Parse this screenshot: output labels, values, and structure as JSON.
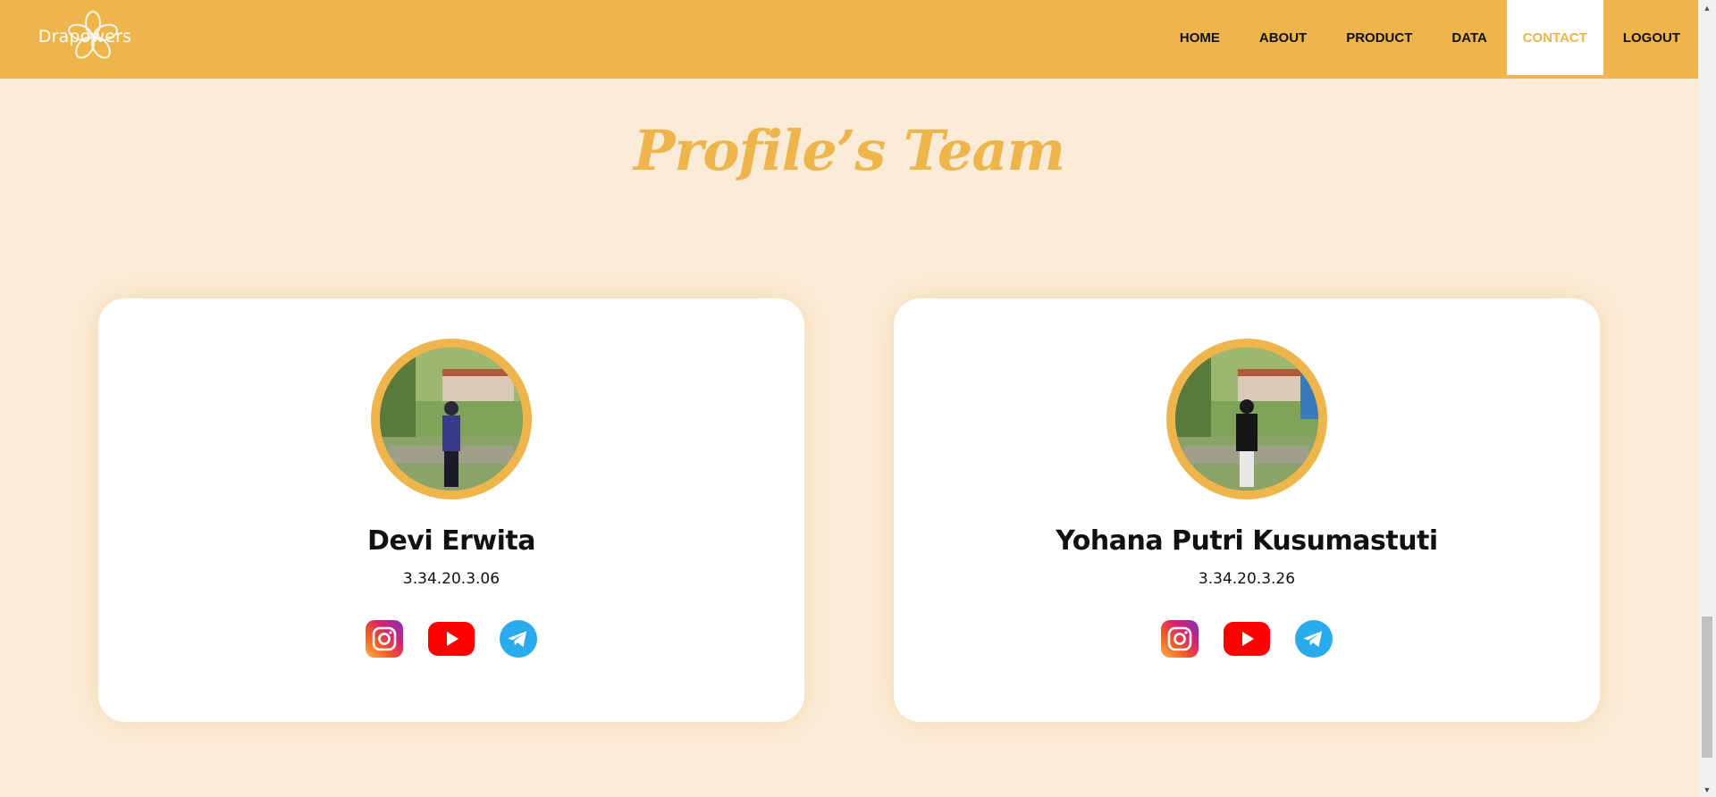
{
  "brand": {
    "name": "Drapowers"
  },
  "nav": {
    "items": [
      {
        "label": "HOME"
      },
      {
        "label": "ABOUT"
      },
      {
        "label": "PRODUCT"
      },
      {
        "label": "DATA"
      },
      {
        "label": "CONTACT",
        "active": true
      },
      {
        "label": "LOGOUT"
      }
    ]
  },
  "section": {
    "title": "Profile’s Team"
  },
  "team": [
    {
      "name": "Devi Erwita",
      "id": "3.34.20.3.06",
      "socials": [
        "instagram-icon",
        "youtube-icon",
        "telegram-icon"
      ]
    },
    {
      "name": "Yohana Putri Kusumastuti",
      "id": "3.34.20.3.26",
      "socials": [
        "instagram-icon",
        "youtube-icon",
        "telegram-icon"
      ]
    }
  ],
  "colors": {
    "accent": "#EDB54B",
    "background": "#FAEBD7",
    "card": "#FFFFFF",
    "youtube": "#FF0000",
    "telegram": "#2AABEE"
  }
}
